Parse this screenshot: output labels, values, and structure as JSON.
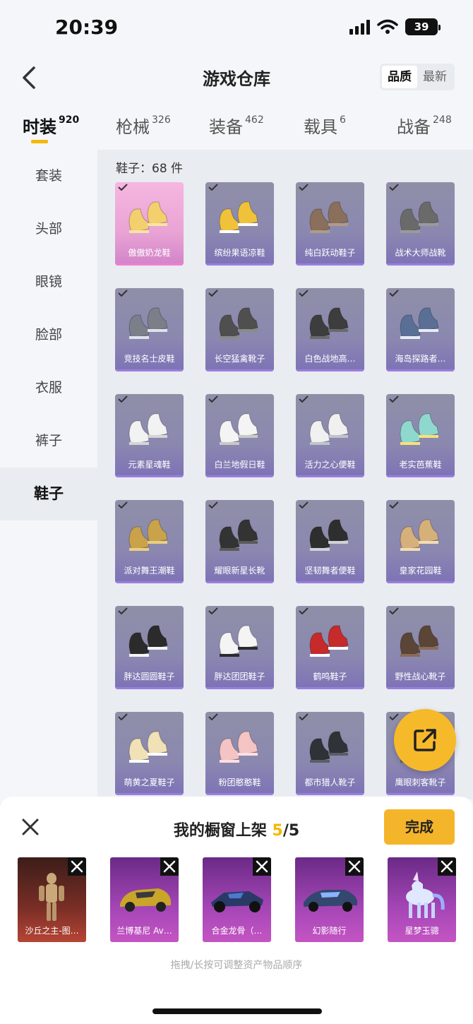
{
  "status": {
    "time": "20:39",
    "battery": "39"
  },
  "header": {
    "title": "游戏仓库",
    "sort": [
      "品质",
      "最新"
    ]
  },
  "tabs": [
    {
      "label": "时装",
      "count": "920"
    },
    {
      "label": "枪械",
      "count": "326"
    },
    {
      "label": "装备",
      "count": "462"
    },
    {
      "label": "载具",
      "count": "6"
    },
    {
      "label": "战备",
      "count": "248"
    }
  ],
  "sidebar": [
    "套装",
    "头部",
    "眼镜",
    "脸部",
    "衣服",
    "裤子",
    "鞋子"
  ],
  "content": {
    "count_label": "鞋子：68 件"
  },
  "items": [
    "傲傲奶龙鞋",
    "缤纷果语凉鞋",
    "纯白跃动鞋子",
    "战术大师战靴",
    "竞技名士皮鞋",
    "长空猛禽靴子",
    "白色战地高…",
    "海岛探路者…",
    "元素星魂鞋",
    "白兰地假日鞋",
    "活力之心便鞋",
    "老实芭蕉鞋",
    "派对舞王潮鞋",
    "耀眼新星长靴",
    "坚韧舞者便鞋",
    "皇家花园鞋",
    "胖达圆圆鞋子",
    "胖达团团鞋子",
    "鹤鸣鞋子",
    "野性战心靴子",
    "萌黄之夏鞋子",
    "粉团憨憨鞋",
    "都市猎人靴子",
    "鹰眼刺客靴子"
  ],
  "sheet": {
    "title_prefix": "我的橱窗上架 ",
    "title_current": "5",
    "title_suffix": "/5",
    "done": "完成",
    "shelf": [
      "沙丘之主-图…",
      "兰博基尼 Av…",
      "合金龙骨（…",
      "幻影随行",
      "星梦玉骢"
    ],
    "hint": "拖拽/长按可调整资产物品顺序"
  }
}
